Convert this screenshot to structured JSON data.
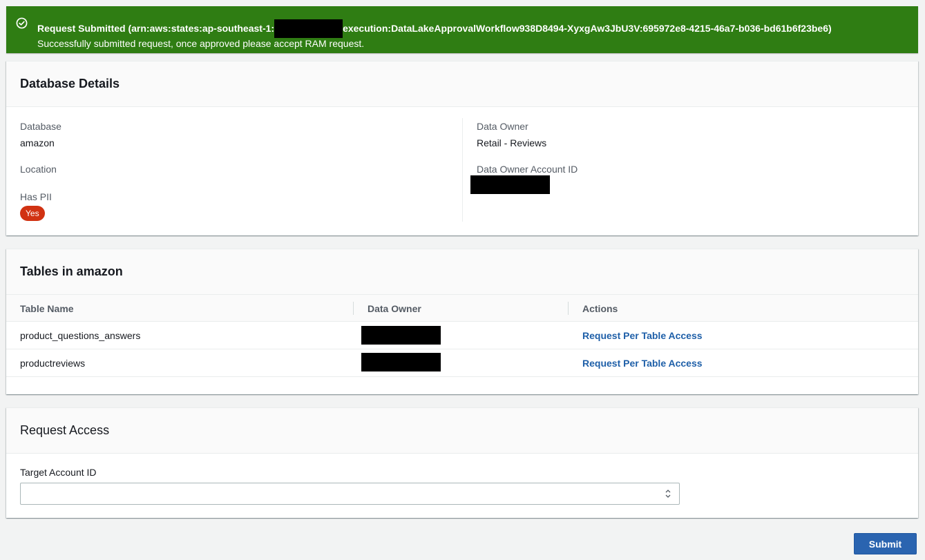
{
  "flash": {
    "title_prefix": "Request Submitted (arn:aws:states:ap-southeast-1:",
    "title_suffix": "execution:DataLakeApprovalWorkflow938D8494-XyxgAw3JbU3V:695972e8-4215-46a7-b036-bd61b6f23be6)",
    "message": "Successfully submitted request, once approved please accept RAM request.",
    "color": "#2f7d13"
  },
  "database_details": {
    "title": "Database Details",
    "database_label": "Database",
    "database_value": "amazon",
    "location_label": "Location",
    "location_value": "",
    "has_pii_label": "Has PII",
    "has_pii_value": "Yes",
    "data_owner_label": "Data Owner",
    "data_owner_value": "Retail - Reviews",
    "data_owner_account_label": "Data Owner Account ID"
  },
  "tables": {
    "title": "Tables in amazon",
    "columns": [
      "Table Name",
      "Data Owner",
      "Actions"
    ],
    "rows": [
      {
        "name": "product_questions_answers",
        "action": "Request Per Table Access"
      },
      {
        "name": "productreviews",
        "action": "Request Per Table Access"
      }
    ]
  },
  "request_access": {
    "title": "Request Access",
    "target_label": "Target Account ID",
    "target_value": ""
  },
  "submit_label": "Submit"
}
